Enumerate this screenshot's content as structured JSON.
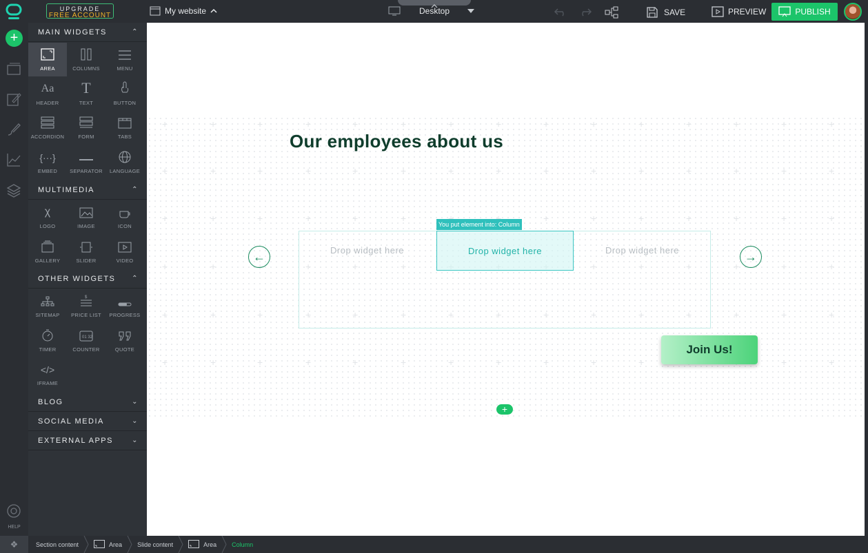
{
  "topbar": {
    "upgrade_line1": "UPGRADE",
    "upgrade_line2": "FREE ACCOUNT",
    "site_name": "My website",
    "device": "Desktop",
    "save_label": "SAVE",
    "preview_label": "PREVIEW",
    "publish_label": "PUBLISH"
  },
  "rail": {
    "help_label": "HELP"
  },
  "panel": {
    "main_widgets": {
      "title": "MAIN WIDGETS",
      "items": [
        "AREA",
        "COLUMNS",
        "MENU",
        "HEADER",
        "TEXT",
        "BUTTON",
        "ACCORDION",
        "FORM",
        "TABS",
        "EMBED",
        "SEPARATOR",
        "LANGUAGE"
      ],
      "active": "AREA"
    },
    "multimedia": {
      "title": "MULTIMEDIA",
      "items": [
        "LOGO",
        "IMAGE",
        "ICON",
        "GALLERY",
        "SLIDER",
        "VIDEO"
      ]
    },
    "other_widgets": {
      "title": "OTHER WIDGETS",
      "items": [
        "SITEMAP",
        "PRICE LIST",
        "PROGRESS",
        "TIMER",
        "COUNTER",
        "QUOTE",
        "IFRAME"
      ]
    },
    "blog": "BLOG",
    "social_media": "SOCIAL MEDIA",
    "external_apps": "EXTERNAL APPS"
  },
  "canvas": {
    "heading": "Our employees about us",
    "drop_1": "Drop widget here",
    "drop_2": "Drop widget here",
    "drop_3": "Drop widget here",
    "hint": "You put element into: Column",
    "join_button": "Join Us!"
  },
  "breadcrumb": [
    "Section content",
    "Area",
    "Slide content",
    "Area",
    "Column"
  ],
  "colors": {
    "accent": "#1cc46a",
    "sidebar": "#2f3338",
    "heading": "#0f3d2c"
  }
}
